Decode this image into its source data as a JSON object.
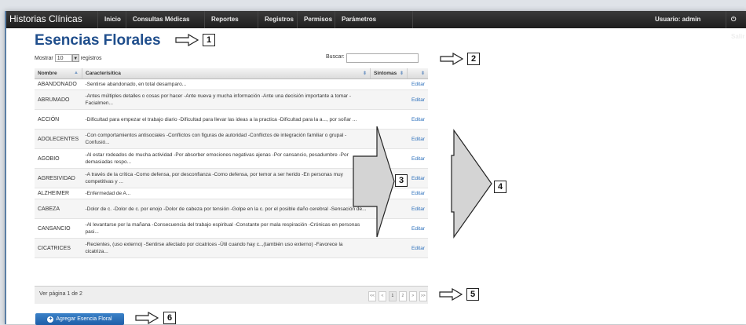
{
  "app": {
    "brand": "Historias Clínicas"
  },
  "nav": {
    "items": [
      "Inicio",
      "Consultas Médicas",
      "Reportes",
      "Registros",
      "Permisos",
      "Parámetros"
    ],
    "user_label": "Usuario: admin",
    "logout_label": "Salir"
  },
  "page": {
    "title": "Esencias Florales"
  },
  "controls": {
    "show_label": "Mostrar",
    "page_size": "10",
    "records_label": "registros",
    "search_label": "Buscar:",
    "search_value": ""
  },
  "table": {
    "headers": {
      "name": "Nombre",
      "characteristic": "Caracterísitica",
      "symptoms": "Sintomas"
    },
    "edit_label": "Editar",
    "rows": [
      {
        "name": "ABANDONADO",
        "characteristic": "-Sentirse abandonado, en total desamparo..."
      },
      {
        "name": "ABRUMADO",
        "characteristic": "-Antes múltiples detalles o cosas por hacer -Ante nueva y mucha información -Ante una decisión importante a tomar -Facialmen..."
      },
      {
        "name": "ACCIÓN",
        "characteristic": "-Dificultad para empezar el trabajo diario -Dificultad para llevar las ideas a la practica -Dificultad para la a..., por soñar ..."
      },
      {
        "name": "ADOLECENTES",
        "characteristic": "-Con comportamientos antisociales -Conflictos con figuras de autoridad -Conflictos de integración familiar o grupal -Confusió..."
      },
      {
        "name": "AGOBIO",
        "characteristic": "-Al estar rodeados de mucha actividad -Por absorber emociones negativas ajenas -Por cansancio, pesadumbre -Por demasiadas respo..."
      },
      {
        "name": "AGRESIVIDAD",
        "characteristic": "-A través de la crítica -Como defensa, por desconfianza -Como defensa, por temor a ser herido -En personas muy competitivas y ..."
      },
      {
        "name": "ALZHEIMER",
        "characteristic": "-Enfermedad de A..."
      },
      {
        "name": "CABEZA",
        "characteristic": "-Dolor de c. -Dolor de c. por enojo -Dolor de cabeza por tensión -Golpe en la c. por el posible daño cerebral -Sensación de..."
      },
      {
        "name": "CANSANCIO",
        "characteristic": "-Al levantarse por la mañana -Consecuencia del trabajo espiritual -Constante por mala respiración -Crónicas en personas pasi..."
      },
      {
        "name": "CICATRICES",
        "characteristic": "-Recientes, (uso externo) -Sentirse afectado por cicatrices -Útil cuando hay c..,(también uso externo) -Favorece la cicatriza..."
      }
    ]
  },
  "footer": {
    "page_info": "Ver página 1 de 2",
    "pager": {
      "first": "<<",
      "prev": "<",
      "page1": "1",
      "page2": "2",
      "next": ">",
      "last": ">>"
    }
  },
  "add_button": {
    "label": "Agregar Esencia Floral"
  },
  "callouts": {
    "c1": "1",
    "c2": "2",
    "c3": "3",
    "c4": "4",
    "c5": "5",
    "c6": "6"
  },
  "colors": {
    "title": "#1f4e8c",
    "link": "#2a6ebb",
    "button": "#1e5ea8",
    "navbar": "#2a2a2a"
  }
}
